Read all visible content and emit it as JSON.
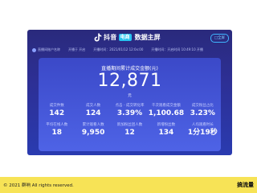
{
  "header": {
    "logo_icon": "douyin-note-icon",
    "logo_text": "抖音",
    "logo_badge": "电商",
    "title": "数据主屏",
    "top_button": "□全屏"
  },
  "info_bar": {
    "account": "直播间账户名称",
    "start_time": "开播于 开启",
    "screen_time": "开播时间：2021/01/12 12:0x:00",
    "end_time": "开播时间：开启时间 10:49:10 开播"
  },
  "panel": {
    "title": "直播期间累计成交金额(元)",
    "gmv": "12,871",
    "gmv_unit": "元",
    "metrics_row1": [
      {
        "label": "成交件数",
        "value": "142"
      },
      {
        "label": "成交人数",
        "value": "124"
      },
      {
        "label": "点击 - 成交转化率",
        "value": "3.39%"
      },
      {
        "label": "千次观看成交金额",
        "value": "1,100.68"
      },
      {
        "label": "成交粉丝占比",
        "value": "3.23%"
      }
    ],
    "metrics_row2": [
      {
        "label": "平均在线人数",
        "value": "18"
      },
      {
        "label": "累计观看人数",
        "value": "9,950"
      },
      {
        "label": "新加粉丝团人数",
        "value": "12"
      },
      {
        "label": "新增粉丝数",
        "value": "134"
      },
      {
        "label": "人均观看时长",
        "value": "1分19秒"
      }
    ]
  },
  "footer": {
    "copyright": "© 2021 群响 All rights reserved.",
    "brand": "搞流量"
  }
}
